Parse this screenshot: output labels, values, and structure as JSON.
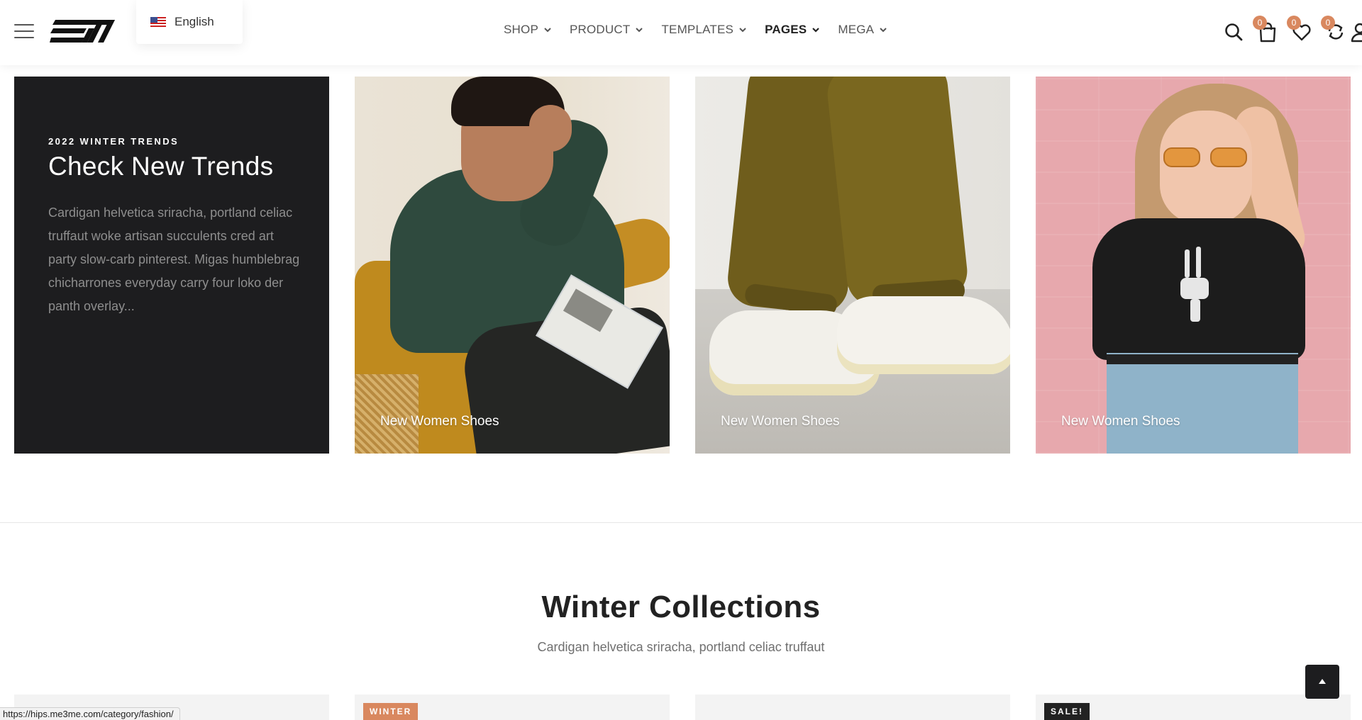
{
  "header": {
    "language": "English",
    "nav": [
      {
        "label": "SHOP"
      },
      {
        "label": "PRODUCT"
      },
      {
        "label": "TEMPLATES"
      },
      {
        "label": "PAGES"
      },
      {
        "label": "MEGA"
      }
    ],
    "active_nav": "PAGES",
    "badges": {
      "cart": "0",
      "wishlist": "0",
      "compare": "0"
    },
    "icons": [
      "menu-icon",
      "logo",
      "search-icon",
      "bag-icon",
      "heart-icon",
      "compare-icon",
      "user-icon"
    ]
  },
  "banner": {
    "kicker": "2022 WINTER TRENDS",
    "title": "Check New Trends",
    "description": "Cardigan helvetica sriracha, portland celiac truffaut woke artisan succulents cred art party slow-carb pinterest. Migas humblebrag chicharrones everyday carry four loko der panth overlay...",
    "cards": [
      {
        "label": "New Women Shoes"
      },
      {
        "label": "New Women Shoes"
      },
      {
        "label": "New Women Shoes"
      }
    ]
  },
  "collections": {
    "title": "Winter Collections",
    "subtitle": "Cardigan helvetica sriracha, portland celiac truffaut",
    "product_tags": [
      "",
      "WINTER",
      "",
      "SALE!"
    ]
  },
  "status_bar": {
    "url": "https://hips.me3me.com/category/fashion/"
  },
  "colors": {
    "accent": "#d9885f",
    "dark": "#1d1d1f",
    "text": "#222222",
    "muted": "#8e8e8e"
  }
}
